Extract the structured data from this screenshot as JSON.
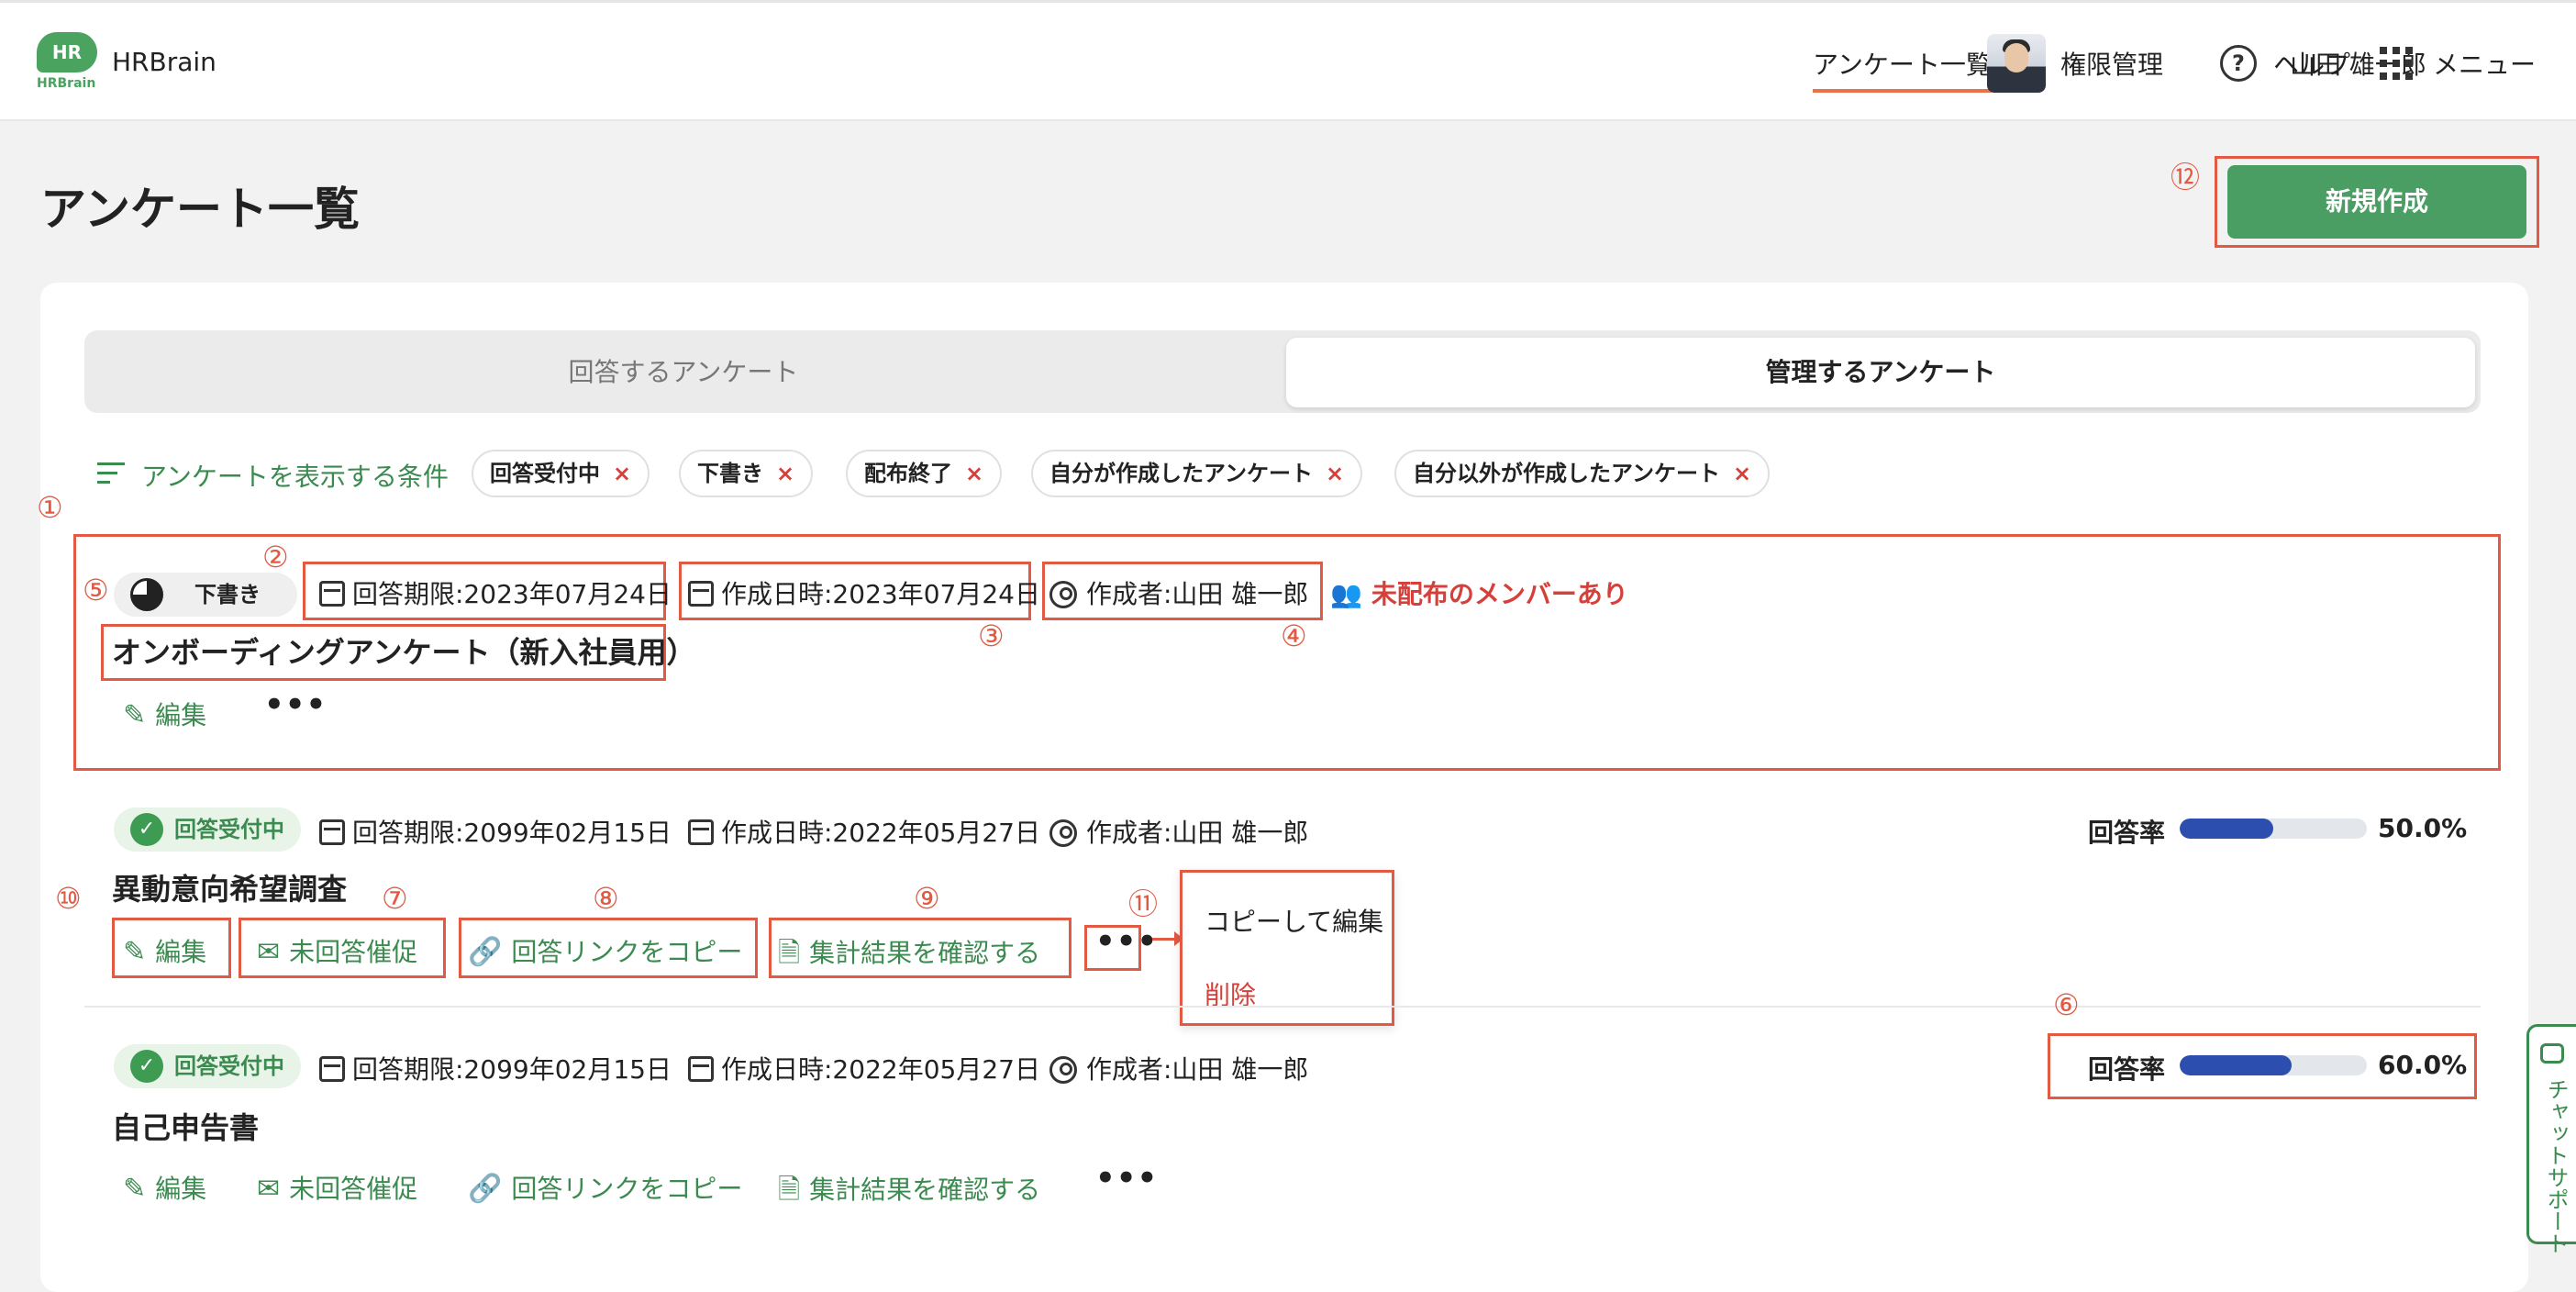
{
  "header": {
    "logo_text": "HR",
    "logo_sub": "HRBrain",
    "brand": "HRBrain",
    "nav": {
      "surveys": "アンケート一覧",
      "permissions": "権限管理",
      "user_name": "山田 雄一郎",
      "help": "ヘルプ",
      "menu": "メニュー"
    }
  },
  "page": {
    "title": "アンケート一覧",
    "new_button": "新規作成"
  },
  "tabs": {
    "answer": "回答するアンケート",
    "manage": "管理するアンケート"
  },
  "filters": {
    "label": "アンケートを表示する条件",
    "chips": [
      "回答受付中",
      "下書き",
      "配布終了",
      "自分が作成したアンケート",
      "自分以外が作成したアンケート"
    ],
    "remove": "×"
  },
  "annotations": [
    "①",
    "②",
    "③",
    "④",
    "⑤",
    "⑥",
    "⑦",
    "⑧",
    "⑨",
    "⑩",
    "⑪",
    "⑫"
  ],
  "actions": {
    "edit": "編集",
    "remind": "未回答催促",
    "copy_link": "回答リンクをコピー",
    "results": "集計結果を確認する",
    "more": "•••"
  },
  "rate_label": "回答率",
  "surveys": [
    {
      "status": "下書き",
      "deadline": "回答期限:2023年07月24日",
      "created": "作成日時:2023年07月24日",
      "author": "作成者:山田 雄一郎",
      "warning": "未配布のメンバーあり",
      "title": "オンボーディングアンケート（新入社員用）"
    },
    {
      "status": "回答受付中",
      "deadline": "回答期限:2099年02月15日",
      "created": "作成日時:2022年05月27日",
      "author": "作成者:山田 雄一郎",
      "title": "異動意向希望調査",
      "rate": 0.5,
      "rate_text": "50.0%"
    },
    {
      "status": "回答受付中",
      "deadline": "回答期限:2099年02月15日",
      "created": "作成日時:2022年05月27日",
      "author": "作成者:山田 雄一郎",
      "title": "自己申告書",
      "rate": 0.6,
      "rate_text": "60.0%"
    }
  ],
  "popup": {
    "copy_edit": "コピーして編集",
    "delete": "削除"
  },
  "chat": {
    "label": "チャットサポート"
  },
  "colors": {
    "accent_green": "#4a9e64",
    "annotation_red": "#e25a43",
    "bar_blue": "#2c4eae"
  }
}
